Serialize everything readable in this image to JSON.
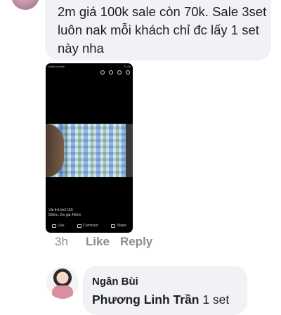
{
  "comment1": {
    "text": "2m giá 100k sale còn 70k. Sale 3set luôn nak mỗi khách chỉ đc lấy 1 set này nha"
  },
  "attachment": {
    "status_left": "Viettel mobile",
    "status_right": "21:29",
    "caption_line1": "Vải thô khổ 150",
    "caption_line2": "50k/m. 2m giá 45k/m",
    "like_label": "Like",
    "comment_label": "Comment",
    "share_label": "Share"
  },
  "comment_meta": {
    "time": "3h",
    "like": "Like",
    "reply": "Reply"
  },
  "comment2": {
    "author": "Ngân Bùi",
    "tag": "Phương Linh Trần",
    "text": " 1 set"
  }
}
